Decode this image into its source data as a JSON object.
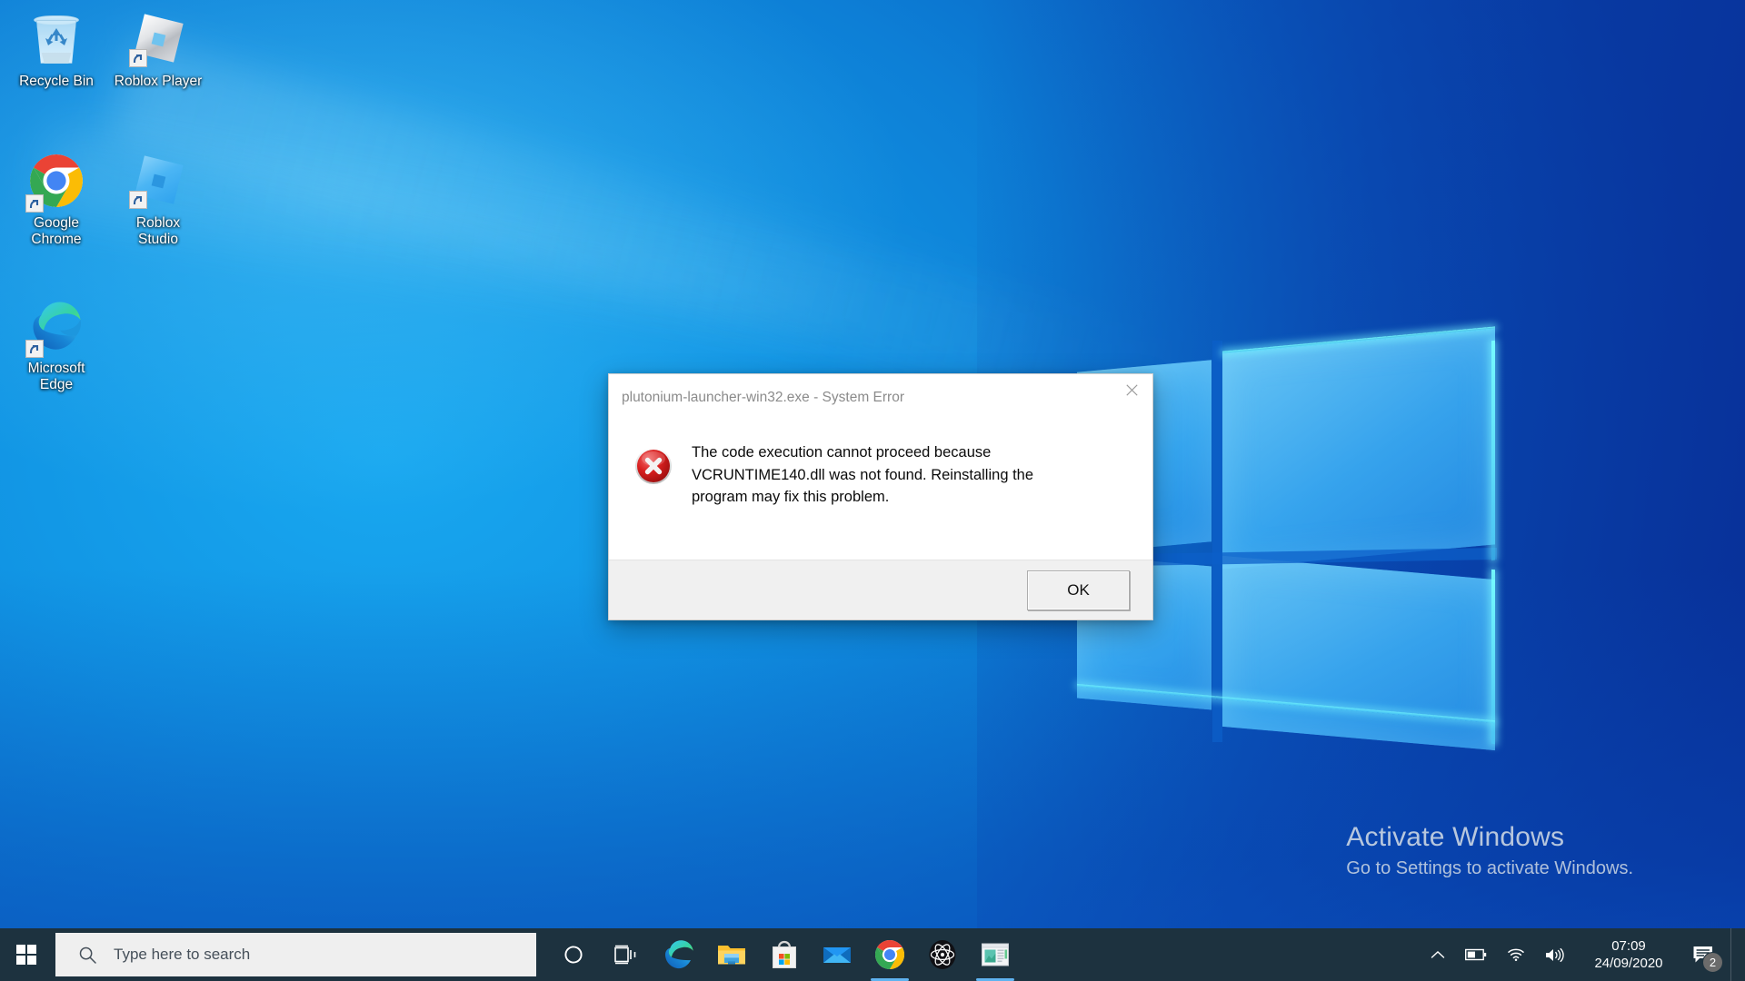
{
  "desktop": {
    "icons": [
      {
        "label": "Recycle Bin",
        "icon": "recycle-bin-icon",
        "shortcut": false
      },
      {
        "label": "Roblox Player",
        "icon": "roblox-player-icon",
        "shortcut": true
      },
      {
        "label": "Google\nChrome",
        "label_line1": "Google",
        "label_line2": "Chrome",
        "icon": "google-chrome-icon",
        "shortcut": true
      },
      {
        "label": "Roblox\nStudio",
        "label_line1": "Roblox",
        "label_line2": "Studio",
        "icon": "roblox-studio-icon",
        "shortcut": true
      },
      {
        "label": "Microsoft\nEdge",
        "label_line1": "Microsoft",
        "label_line2": "Edge",
        "icon": "microsoft-edge-icon",
        "shortcut": true
      }
    ]
  },
  "watermark": {
    "title": "Activate Windows",
    "subtitle": "Go to Settings to activate Windows."
  },
  "dialog": {
    "title": "plutonium-launcher-win32.exe - System Error",
    "close_label": "✕",
    "icon": "error-icon",
    "message": "The code execution cannot proceed because VCRUNTIME140.dll was not found. Reinstalling the program may fix this problem.",
    "ok_label": "OK"
  },
  "taskbar": {
    "start_label": "Start",
    "search": {
      "placeholder": "Type here to search",
      "icon": "search-icon"
    },
    "cortana_label": "Cortana",
    "task_view_label": "Task View",
    "apps": [
      {
        "name": "microsoft-edge",
        "label": "Microsoft Edge",
        "active": false
      },
      {
        "name": "file-explorer",
        "label": "File Explorer",
        "active": false
      },
      {
        "name": "microsoft-store",
        "label": "Microsoft Store",
        "active": false
      },
      {
        "name": "mail",
        "label": "Mail",
        "active": false
      },
      {
        "name": "google-chrome",
        "label": "Google Chrome",
        "active": true
      },
      {
        "name": "electron-app",
        "label": "Electron",
        "active": false
      },
      {
        "name": "photos-app",
        "label": "Photos",
        "active": true
      }
    ],
    "tray": {
      "chevron_label": "Show hidden icons",
      "battery_label": "Battery",
      "network_label": "Network",
      "volume_label": "Volume",
      "time": "07:09",
      "date": "24/09/2020",
      "notifications_count": "2"
    }
  },
  "colors": {
    "taskbar": "#1d323f",
    "accent": "#0078d7",
    "error_red": "#cf1b1b",
    "search_bg": "#efefef",
    "dialog_footer": "#f0f0f0"
  }
}
